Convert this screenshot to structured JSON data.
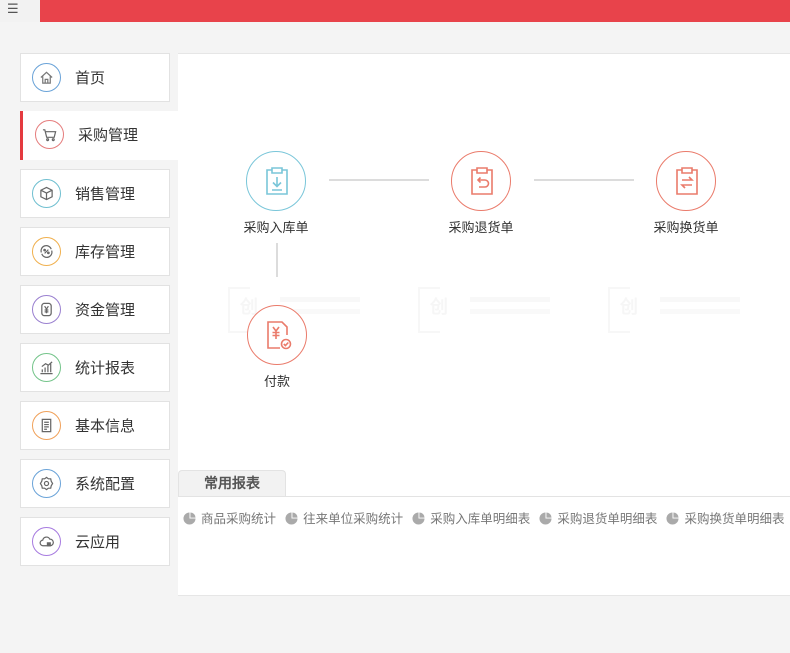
{
  "menu_glyph": "☰",
  "colors": {
    "topbar": "#e8434b",
    "active_indicator": "#e43a3f"
  },
  "sidebar": {
    "items": [
      {
        "label": "首页",
        "icon": "home-icon",
        "color": "#6aa3d8"
      },
      {
        "label": "采购管理",
        "icon": "cart-icon",
        "color": "#e57d7d",
        "active": true
      },
      {
        "label": "销售管理",
        "icon": "box-icon",
        "color": "#6fbfd0"
      },
      {
        "label": "库存管理",
        "icon": "inventory-percent-icon",
        "color": "#f0b04e"
      },
      {
        "label": "资金管理",
        "icon": "money-icon",
        "color": "#9a80d0"
      },
      {
        "label": "统计报表",
        "icon": "chart-icon",
        "color": "#74c48a"
      },
      {
        "label": "基本信息",
        "icon": "document-icon",
        "color": "#f0a15a"
      },
      {
        "label": "系统配置",
        "icon": "gear-icon",
        "color": "#6aa3d8"
      },
      {
        "label": "云应用",
        "icon": "cloud-icon",
        "color": "#a77be0"
      }
    ]
  },
  "flow": {
    "nodes": [
      {
        "label": "采购入库单",
        "icon": "clipboard-download-icon",
        "color": "#7ac6d9"
      },
      {
        "label": "采购退货单",
        "icon": "clipboard-return-icon",
        "color": "#ea7b6b"
      },
      {
        "label": "采购换货单",
        "icon": "clipboard-exchange-icon",
        "color": "#ea7b6b"
      },
      {
        "label": "付款",
        "icon": "payment-yuan-icon",
        "color": "#ea7b6b"
      }
    ]
  },
  "reports": {
    "tab_label": "常用报表",
    "links": [
      "商品采购统计",
      "往来单位采购统计",
      "采购入库单明细表",
      "采购退货单明细表",
      "采购换货单明细表"
    ]
  }
}
